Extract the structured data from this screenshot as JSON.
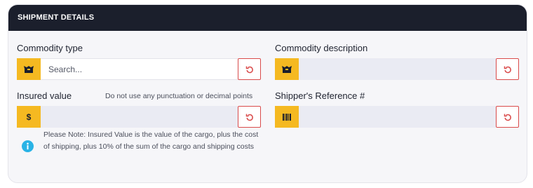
{
  "header": {
    "title": "SHIPMENT DETAILS"
  },
  "commodity_type": {
    "label": "Commodity type",
    "placeholder": "Search...",
    "value": "",
    "prefix_icon": "box-icon",
    "reset_icon": "undo-icon"
  },
  "commodity_description": {
    "label": "Commodity description",
    "value": "",
    "prefix_icon": "box-icon",
    "reset_icon": "undo-icon"
  },
  "insured_value": {
    "label": "Insured value",
    "hint": "Do not use any punctuation or decimal points",
    "prefix_symbol": "$",
    "value": "",
    "reset_icon": "undo-icon"
  },
  "shipper_reference": {
    "label": "Shipper's Reference #",
    "value": "",
    "prefix_icon": "barcode-icon",
    "reset_icon": "undo-icon"
  },
  "note": {
    "text": "Please Note: Insured Value is the value of the cargo, plus the cost of shipping, plus 10% of the sum of the cargo and shipping costs",
    "icon": "info-icon"
  },
  "colors": {
    "header_bg": "#1b1f2c",
    "accent_yellow": "#f5b921",
    "reset_border": "#d94b4b",
    "info_blue": "#2ab3e6",
    "input_bg": "#eaebf3"
  }
}
